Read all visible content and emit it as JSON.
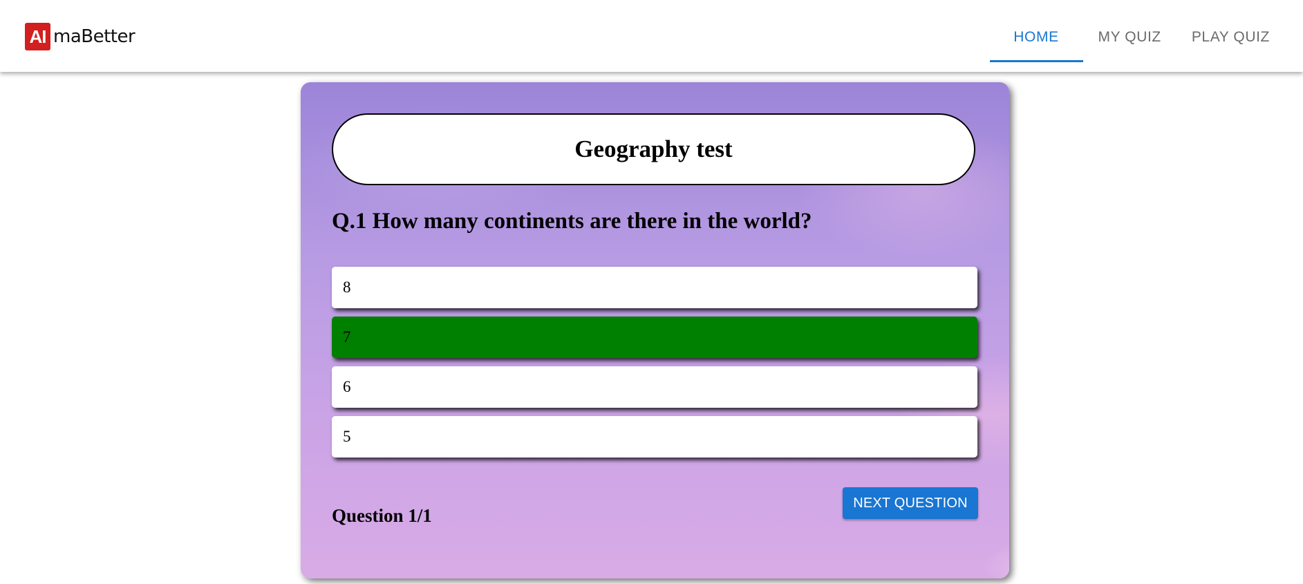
{
  "brand": {
    "logo_mark": "AI",
    "logo_text": "maBetter",
    "mark_color": "#d21f1f"
  },
  "nav": {
    "tabs": [
      {
        "label": "HOME",
        "active": true
      },
      {
        "label": "MY QUIZ",
        "active": false
      },
      {
        "label": "PLAY QUIZ",
        "active": false
      }
    ],
    "active_color": "#1976d2"
  },
  "quiz": {
    "title": "Geography test",
    "question": "Q.1 How many continents are there in the world?",
    "options": [
      {
        "label": "8",
        "selected": false
      },
      {
        "label": "7",
        "selected": true
      },
      {
        "label": "6",
        "selected": false
      },
      {
        "label": "5",
        "selected": false
      }
    ],
    "selected_color": "#008000",
    "counter": "Question 1/1",
    "next_label": "NEXT QUESTION",
    "next_color": "#1976d2"
  }
}
